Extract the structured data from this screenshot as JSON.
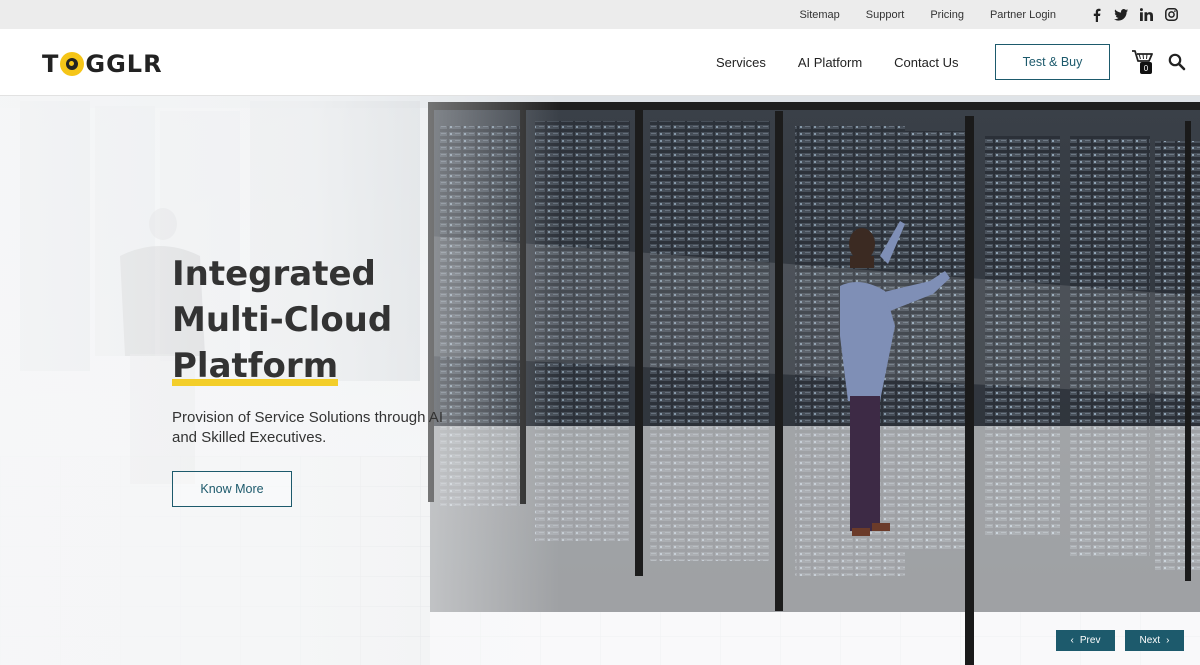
{
  "topbar": {
    "links": [
      "Sitemap",
      "Support",
      "Pricing",
      "Partner Login"
    ],
    "social": [
      "facebook-icon",
      "twitter-icon",
      "linkedin-icon",
      "instagram-icon"
    ]
  },
  "header": {
    "logo_pre": "T",
    "logo_post": "GGLR",
    "nav": [
      "Services",
      "AI Platform",
      "Contact Us"
    ],
    "cta_label": "Test & Buy",
    "cart_count": "0",
    "icons": {
      "cart": "cart-icon",
      "search": "search-icon"
    }
  },
  "hero": {
    "title_line1": "Integrated",
    "title_line2": "Multi-Cloud",
    "title_line3": "Platform",
    "subtitle": "Provision of Service Solutions through AI and Skilled Executives.",
    "button_label": "Know More",
    "prev_label": "Prev",
    "next_label": "Next"
  },
  "colors": {
    "accent": "#1d5a6c",
    "highlight": "#f3ce2a",
    "logo_yellow": "#f5c518",
    "topbar_bg": "#ececec"
  }
}
